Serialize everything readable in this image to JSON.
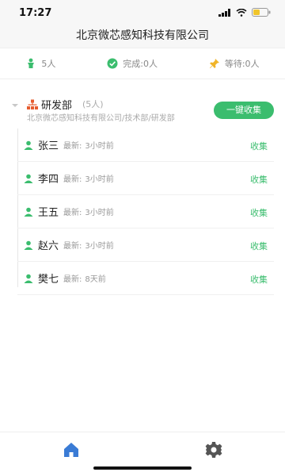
{
  "status": {
    "time": "17:27",
    "icons": [
      "location-icon",
      "signal-icon",
      "wifi-icon",
      "battery-icon"
    ]
  },
  "header": {
    "title": "北京微芯感知科技有限公司"
  },
  "stats": [
    {
      "icon": "person-icon",
      "label": "5人"
    },
    {
      "icon": "check-circle-icon",
      "label": "完成:0人"
    },
    {
      "icon": "pin-icon",
      "label": "等待:0人"
    }
  ],
  "department": {
    "name": "研发部",
    "count": "(5人)",
    "path": "北京微芯感知科技有限公司/技术部/研发部",
    "collect_all": "一键收集"
  },
  "members": [
    {
      "name": "张三",
      "meta": "最新:",
      "time": "3小时前",
      "action": "收集"
    },
    {
      "name": "李四",
      "meta": "最新:",
      "time": "3小时前",
      "action": "收集"
    },
    {
      "name": "王五",
      "meta": "最新:",
      "time": "3小时前",
      "action": "收集"
    },
    {
      "name": "赵六",
      "meta": "最新:",
      "time": "3小时前",
      "action": "收集"
    },
    {
      "name": "樊七",
      "meta": "最新:",
      "time": "8天前",
      "action": "收集"
    }
  ],
  "tabs": [
    {
      "icon": "home-icon"
    },
    {
      "icon": "gear-icon"
    }
  ],
  "colors": {
    "accent": "#3bbd6e",
    "home_blue": "#3a7bd5",
    "pin": "#f0b429",
    "dept_icon": "#e65c2f"
  }
}
